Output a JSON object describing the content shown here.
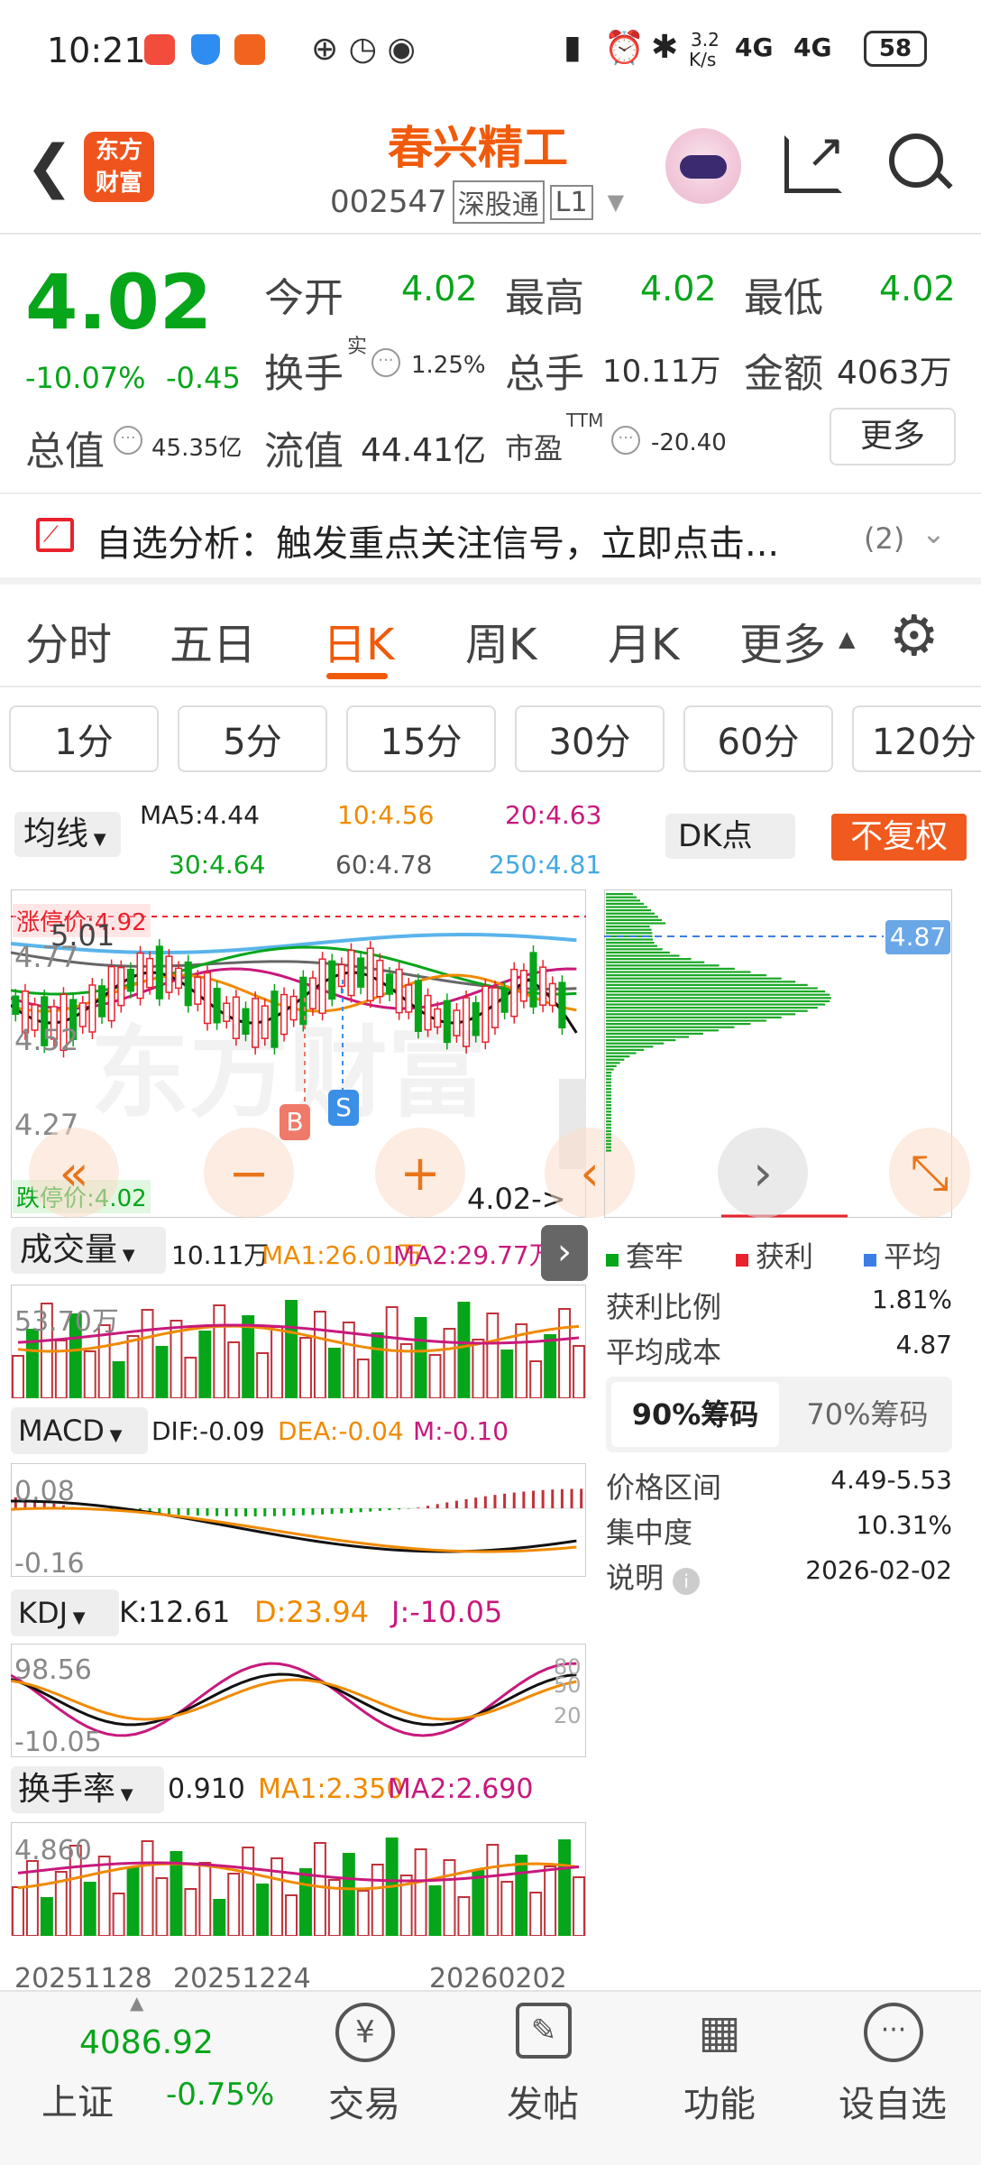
{
  "status": {
    "time": "10:21",
    "net_speed_top": "3.2",
    "net_speed_bottom": "K/s",
    "net1": "4G",
    "net2": "4G",
    "battery": "58"
  },
  "header": {
    "brand_line1": "东方",
    "brand_line2": "财富",
    "title": "春兴精工",
    "code": "002547",
    "tag1": "深股通",
    "tag2": "L1"
  },
  "quote": {
    "price": "4.02",
    "pct": "-10.07%",
    "chg": "-0.45",
    "open_label": "今开",
    "open": "4.02",
    "high_label": "最高",
    "high": "4.02",
    "low_label": "最低",
    "low": "4.02",
    "turnover_label": "换手",
    "turnover_sup": "实",
    "turnover": "1.25%",
    "vol_label": "总手",
    "vol": "10.11万",
    "amt_label": "金额",
    "amt": "4063万",
    "mcap_label": "总值",
    "mcap": "45.35亿",
    "fcap_label": "流值",
    "fcap": "44.41亿",
    "pe_label": "市盈",
    "pe_sup": "TTM",
    "pe": "-20.40",
    "more": "更多"
  },
  "alert": {
    "text": "自选分析：触发重点关注信号，立即点击...",
    "count": "(2)"
  },
  "tabs": [
    "分时",
    "五日",
    "日K",
    "周K",
    "月K",
    "更多"
  ],
  "active_tab": 2,
  "periods": [
    "1分",
    "5分",
    "15分",
    "30分",
    "60分",
    "120分"
  ],
  "ma": {
    "selector": "均线",
    "ma5": "MA5:4.44",
    "ma10": "10:4.56",
    "ma20": "20:4.63",
    "ma30": "30:4.64",
    "ma60": "60:4.78",
    "ma250": "250:4.81"
  },
  "dk": "DK点",
  "fq": "不复权",
  "kline": {
    "limit_up": "涨停价:4.92",
    "limit_down": "跌停价:4.02",
    "y1": "5.01",
    "y2": "4.77",
    "y3": "4.52",
    "y4": "4.27",
    "y5": "4.02",
    "last": "4.02->",
    "buy": "B",
    "sell": "S",
    "watermark": "东方财富"
  },
  "chips": {
    "level": "4.87",
    "legend": [
      "套牢",
      "获利",
      "平均"
    ],
    "profit_label": "获利比例",
    "profit": "1.81%",
    "avg_label": "平均成本",
    "avg": "4.87",
    "tab90": "90%筹码",
    "tab70": "70%筹码",
    "range_label": "价格区间",
    "range": "4.49-5.53",
    "conc_label": "集中度",
    "conc": "10.31%",
    "note_label": "说明",
    "note": "2026-02-02"
  },
  "vol": {
    "selector": "成交量",
    "v": "10.11万",
    "ma1": "MA1:26.01万",
    "ma2": "MA2:29.77万",
    "ytop": "53.70万"
  },
  "macd": {
    "selector": "MACD",
    "dif": "DIF:-0.09",
    "dea": "DEA:-0.04",
    "m": "M:-0.10",
    "ytop": "0.08",
    "ybot": "-0.16"
  },
  "kdj": {
    "selector": "KDJ",
    "k": "K:12.61",
    "d": "D:23.94",
    "j": "J:-10.05",
    "ytop": "98.56",
    "ybot": "-10.05",
    "r80": "80",
    "r50": "50",
    "r20": "20"
  },
  "hsl": {
    "selector": "换手率",
    "v": "0.910",
    "ma1": "MA1:2.350",
    "ma2": "MA2:2.690",
    "ytop": "4.860"
  },
  "dates": [
    "20251128",
    "20251224",
    "20260202"
  ],
  "bottom": {
    "index_value": "4086.92",
    "index_name": "上证",
    "index_pct": "-0.75%",
    "items": [
      "交易",
      "发帖",
      "功能",
      "设自选"
    ]
  }
}
